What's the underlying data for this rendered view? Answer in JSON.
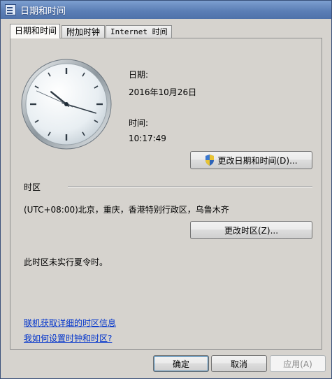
{
  "window": {
    "title": "日期和时间"
  },
  "tabs": [
    {
      "label": "日期和时间"
    },
    {
      "label": "附加时钟"
    },
    {
      "label": "Internet 时间"
    }
  ],
  "clock": {
    "hour": 10,
    "minute": 17,
    "second": 49
  },
  "date": {
    "label": "日期:",
    "value": "2016年10月26日"
  },
  "time": {
    "label": "时间:",
    "value": "10:17:49"
  },
  "buttons": {
    "change_datetime": "更改日期和时间(D)...",
    "change_timezone": "更改时区(Z)...",
    "ok": "确定",
    "cancel": "取消",
    "apply": "应用(A)"
  },
  "timezone": {
    "heading": "时区",
    "value": "(UTC+08:00)北京，重庆，香港特别行政区，乌鲁木齐",
    "dst_note": "此时区未实行夏令时。"
  },
  "links": {
    "tz_info": "联机获取详细的时区信息",
    "how_to": "我如何设置时钟和时区?"
  }
}
